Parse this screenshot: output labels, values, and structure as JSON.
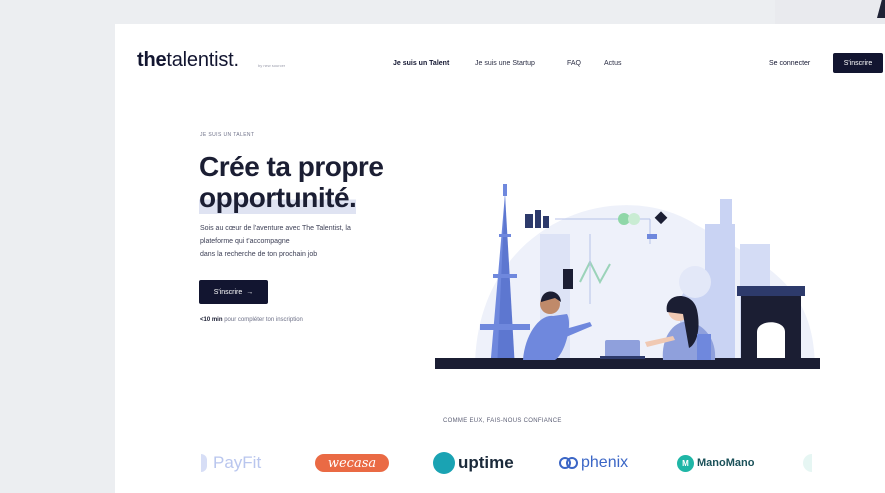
{
  "header": {
    "logo_bold": "the",
    "logo_rest": "talentist",
    "logo_dot": ".",
    "logo_sub": "by new sourcer",
    "nav": [
      "Je suis un Talent",
      "Je suis une Startup",
      "FAQ",
      "Actus"
    ],
    "login": "Se connecter",
    "signup": "S'inscrire"
  },
  "hero": {
    "eyebrow": "JE SUIS UN TALENT",
    "title_line1": "Crée ta propre",
    "title_line2": "opportunité.",
    "para_line1": "Sois au cœur de l'aventure avec The Talentist, la",
    "para_line2": "plateforme qui t'accompagne",
    "para_line3": "dans la recherche de ton prochain job",
    "cta_label": "S'inscrire",
    "cta_arrow": "→",
    "hint_bold": "<10 min",
    "hint_rest": "pour compléter ton inscription"
  },
  "trust": {
    "label": "COMME EUX, FAIS-NOUS CONFIANCE",
    "brands": [
      "PayFit",
      "wecasa",
      "uptime",
      "phenix",
      "ManoMano"
    ]
  },
  "colors": {
    "navy": "#121530",
    "illustration_blue": "#6f88dd",
    "illustration_light": "#c9d3f3",
    "wecasa": "#ea6a44",
    "uptime": "#1aa3b3",
    "mano": "#1fb6a6"
  }
}
